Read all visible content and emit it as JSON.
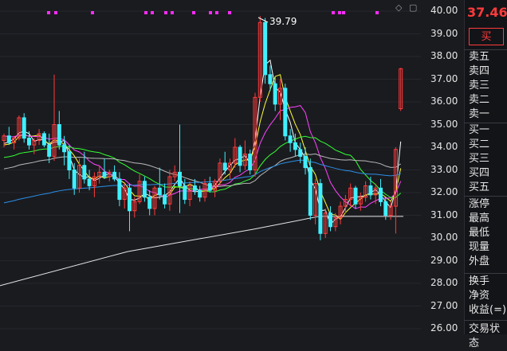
{
  "chart_data": {
    "type": "candlestick",
    "ylim": [
      26,
      40
    ],
    "yticks": [
      "40.00",
      "39.00",
      "38.00",
      "37.00",
      "36.00",
      "35.00",
      "34.00",
      "33.00",
      "32.00",
      "31.00",
      "30.00",
      "29.00",
      "28.00",
      "27.00",
      "26.00"
    ],
    "high_marker": "39.79",
    "candles": [
      [
        34.3,
        34.6,
        34.0,
        34.5
      ],
      [
        34.5,
        34.9,
        34.1,
        34.2
      ],
      [
        34.2,
        34.5,
        33.9,
        34.4
      ],
      [
        34.4,
        35.4,
        34.3,
        35.3
      ],
      [
        35.3,
        35.5,
        34.2,
        34.4
      ],
      [
        34.4,
        34.7,
        33.9,
        34.1
      ],
      [
        34.1,
        34.4,
        33.7,
        34.3
      ],
      [
        34.3,
        34.8,
        34.1,
        34.6
      ],
      [
        34.6,
        34.7,
        34.0,
        34.1
      ],
      [
        34.1,
        34.6,
        33.3,
        33.6
      ],
      [
        33.6,
        37.2,
        33.4,
        35.0
      ],
      [
        35.0,
        35.6,
        33.9,
        34.1
      ],
      [
        34.1,
        34.5,
        33.2,
        33.8
      ],
      [
        33.8,
        34.1,
        32.6,
        33.0
      ],
      [
        33.0,
        33.3,
        31.9,
        32.2
      ],
      [
        32.2,
        33.5,
        32.0,
        33.2
      ],
      [
        33.2,
        33.8,
        32.4,
        32.6
      ],
      [
        32.6,
        33.0,
        32.1,
        32.3
      ],
      [
        32.3,
        32.9,
        31.8,
        32.7
      ],
      [
        32.7,
        33.2,
        32.4,
        32.9
      ],
      [
        32.9,
        33.5,
        32.6,
        32.7
      ],
      [
        32.7,
        33.0,
        32.5,
        32.9
      ],
      [
        32.9,
        33.2,
        32.5,
        32.6
      ],
      [
        32.6,
        32.9,
        31.4,
        31.7
      ],
      [
        31.7,
        32.4,
        31.3,
        32.2
      ],
      [
        32.2,
        32.4,
        30.3,
        31.2
      ],
      [
        31.2,
        31.8,
        30.9,
        31.6
      ],
      [
        31.6,
        32.8,
        31.5,
        32.5
      ],
      [
        32.5,
        32.7,
        31.6,
        31.8
      ],
      [
        31.8,
        32.1,
        31.0,
        31.3
      ],
      [
        31.3,
        32.3,
        31.0,
        32.2
      ],
      [
        32.2,
        33.1,
        31.7,
        31.9
      ],
      [
        31.9,
        32.4,
        31.3,
        31.5
      ],
      [
        31.5,
        33.0,
        31.2,
        32.7
      ],
      [
        32.7,
        33.2,
        32.5,
        32.9
      ],
      [
        32.9,
        35.0,
        31.1,
        32.3
      ],
      [
        32.3,
        32.6,
        31.5,
        31.7
      ],
      [
        31.7,
        32.5,
        31.4,
        32.3
      ],
      [
        32.3,
        32.6,
        31.9,
        32.1
      ],
      [
        32.1,
        32.3,
        31.6,
        31.8
      ],
      [
        31.8,
        32.6,
        31.6,
        32.4
      ],
      [
        32.4,
        32.7,
        32.0,
        32.1
      ],
      [
        32.1,
        32.6,
        31.8,
        32.5
      ],
      [
        32.5,
        33.5,
        32.3,
        33.3
      ],
      [
        33.3,
        33.8,
        32.8,
        33.0
      ],
      [
        33.0,
        33.5,
        32.6,
        33.3
      ],
      [
        33.3,
        34.4,
        33.1,
        34.0
      ],
      [
        34.0,
        34.1,
        32.9,
        33.2
      ],
      [
        33.2,
        34.3,
        33.0,
        33.7
      ],
      [
        33.7,
        33.9,
        32.8,
        33.0
      ],
      [
        33.0,
        36.4,
        32.7,
        36.2
      ],
      [
        36.2,
        39.79,
        36.0,
        39.5
      ],
      [
        39.5,
        39.7,
        36.8,
        37.2
      ],
      [
        37.2,
        37.6,
        36.5,
        36.8
      ],
      [
        36.8,
        37.1,
        35.6,
        35.9
      ],
      [
        35.9,
        37.0,
        35.2,
        36.6
      ],
      [
        36.6,
        36.8,
        34.3,
        34.5
      ],
      [
        34.5,
        34.8,
        33.8,
        34.2
      ],
      [
        34.2,
        34.6,
        33.6,
        33.9
      ],
      [
        33.9,
        34.2,
        33.3,
        33.6
      ],
      [
        33.6,
        34.0,
        32.8,
        33.1
      ],
      [
        33.1,
        33.5,
        30.8,
        31.0
      ],
      [
        31.0,
        32.6,
        30.6,
        32.4
      ],
      [
        32.4,
        32.6,
        29.9,
        30.2
      ],
      [
        30.2,
        31.3,
        30.0,
        31.1
      ],
      [
        31.1,
        31.4,
        30.3,
        30.5
      ],
      [
        30.5,
        31.1,
        30.3,
        30.9
      ],
      [
        30.9,
        31.6,
        30.6,
        31.4
      ],
      [
        31.4,
        31.9,
        31.1,
        31.7
      ],
      [
        31.7,
        32.4,
        31.4,
        32.2
      ],
      [
        32.2,
        32.3,
        31.3,
        31.5
      ],
      [
        31.5,
        32.0,
        31.2,
        31.8
      ],
      [
        31.8,
        32.5,
        31.6,
        32.3
      ],
      [
        32.3,
        32.7,
        31.7,
        31.9
      ],
      [
        31.9,
        32.4,
        31.5,
        32.2
      ],
      [
        32.2,
        32.6,
        31.4,
        31.6
      ],
      [
        31.6,
        31.8,
        30.8,
        31.0
      ],
      [
        31.0,
        31.6,
        30.8,
        31.4
      ],
      [
        31.4,
        34.0,
        30.2,
        33.9
      ],
      [
        35.7,
        37.5,
        35.6,
        37.46
      ]
    ],
    "flag_rows": [
      [
        59,
        68
      ],
      [
        114
      ],
      [
        181,
        189
      ],
      [
        206,
        214
      ],
      [
        241
      ],
      [
        262,
        270
      ],
      [
        286
      ],
      [
        416,
        424,
        429
      ],
      [
        471
      ]
    ]
  },
  "toolbar": {
    "diamond": "◇",
    "square": "▢"
  },
  "quote": {
    "price": "37.46",
    "buy_label": "买"
  },
  "order_book": {
    "sell": [
      "卖五",
      "卖四",
      "卖三",
      "卖二",
      "卖一"
    ],
    "buy": [
      "买一",
      "买二",
      "买三",
      "买四",
      "买五"
    ]
  },
  "stats": [
    "涨停",
    "最高",
    "最低",
    "现量",
    "外盘"
  ],
  "extra": [
    "换手",
    "净资",
    "收益(=)"
  ],
  "footer": "交易状态"
}
